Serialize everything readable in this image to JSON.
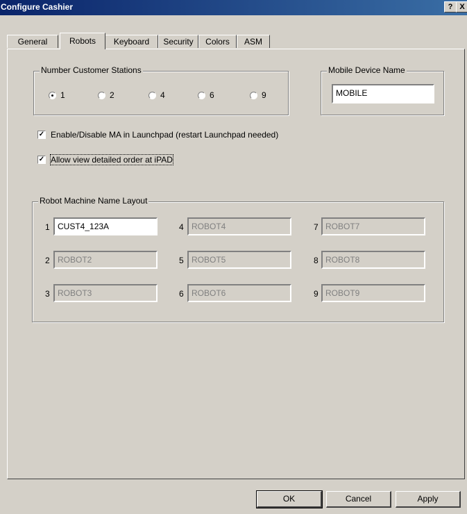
{
  "window": {
    "title": "Configure Cashier",
    "help_label": "?",
    "close_label": "X"
  },
  "tabs": [
    {
      "label": "General"
    },
    {
      "label": "Robots",
      "active": true
    },
    {
      "label": "Keyboard"
    },
    {
      "label": "Security"
    },
    {
      "label": "Colors"
    },
    {
      "label": "ASM"
    }
  ],
  "stations": {
    "legend": "Number Customer Stations",
    "options": [
      "1",
      "2",
      "4",
      "6",
      "9"
    ],
    "selected": "1"
  },
  "mobile": {
    "legend": "Mobile Device Name",
    "value": "MOBILE"
  },
  "checkboxes": {
    "enable_ma": {
      "label": "Enable/Disable MA in Launchpad (restart Launchpad needed)",
      "checked": true
    },
    "allow_view": {
      "label": "Allow view detailed order at iPAD",
      "checked": true
    }
  },
  "robots": {
    "legend": "Robot Machine Name Layout",
    "fields": [
      {
        "num": "1",
        "value": "CUST4_123A",
        "enabled": true
      },
      {
        "num": "2",
        "value": "ROBOT2",
        "enabled": false
      },
      {
        "num": "3",
        "value": "ROBOT3",
        "enabled": false
      },
      {
        "num": "4",
        "value": "ROBOT4",
        "enabled": false
      },
      {
        "num": "5",
        "value": "ROBOT5",
        "enabled": false
      },
      {
        "num": "6",
        "value": "ROBOT6",
        "enabled": false
      },
      {
        "num": "7",
        "value": "ROBOT7",
        "enabled": false
      },
      {
        "num": "8",
        "value": "ROBOT8",
        "enabled": false
      },
      {
        "num": "9",
        "value": "ROBOT9",
        "enabled": false
      }
    ]
  },
  "buttons": {
    "ok": "OK",
    "cancel": "Cancel",
    "apply": "Apply"
  }
}
